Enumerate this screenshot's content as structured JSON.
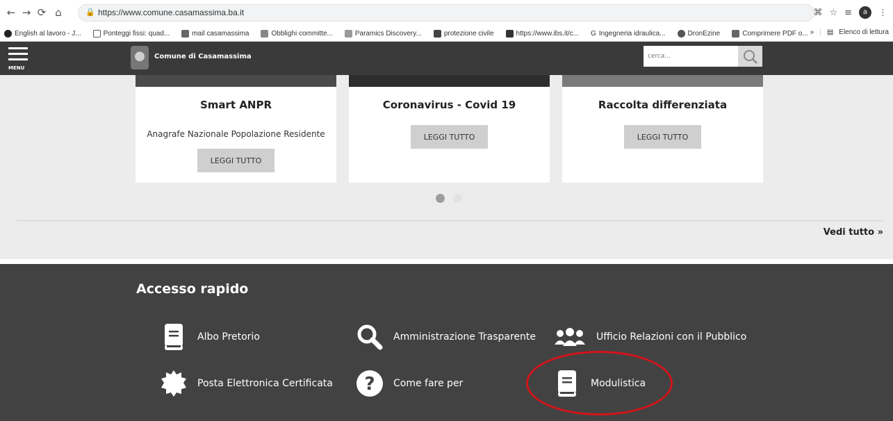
{
  "browser": {
    "url": "https://www.comune.casamassima.ba.it",
    "bookmarks": [
      "English al lavoro - J...",
      "Ponteggi fissi: quad...",
      "mail casamassima",
      "Obblighi committe...",
      "Paramics Discovery...",
      "protezione civile",
      "https://www.ibs.it/c...",
      "Ingegneria idraulica...",
      "DronEzine",
      "Comprimere PDF o..."
    ],
    "bookmarks_overflow": "»",
    "reading_list": "Elenco di lettura",
    "avatar_letter": "a"
  },
  "header": {
    "menu_label": "MENU",
    "site_title": "Comune di Casamassima",
    "search_placeholder": "cerca..."
  },
  "cards": [
    {
      "title": "Smart ANPR",
      "description": "Anagrafe Nazionale Popolazione Residente",
      "button": "LEGGI TUTTO"
    },
    {
      "title": "Coronavirus - Covid 19",
      "description": "",
      "button": "LEGGI TUTTO"
    },
    {
      "title": "Raccolta differenziata",
      "description": "",
      "button": "LEGGI TUTTO"
    }
  ],
  "carousel": {
    "pages": 2,
    "active": 1
  },
  "vedi_tutto": "Vedi tutto »",
  "accesso_rapido": {
    "title": "Accesso rapido",
    "items": [
      {
        "label": "Albo Pretorio",
        "icon": "book-icon"
      },
      {
        "label": "Amministrazione Trasparente",
        "icon": "search-icon"
      },
      {
        "label": "Ufficio Relazioni con il Pubblico",
        "icon": "group-icon"
      },
      {
        "label": "Posta Elettronica Certificata",
        "icon": "seal-icon"
      },
      {
        "label": "Come fare per",
        "icon": "question-icon"
      },
      {
        "label": "Modulistica",
        "icon": "book-icon"
      }
    ]
  },
  "colors": {
    "header_bg": "#3a3a3a",
    "footer_bg": "#424242",
    "button_bg": "#cfcfcf",
    "annotation": "#d2141b"
  }
}
